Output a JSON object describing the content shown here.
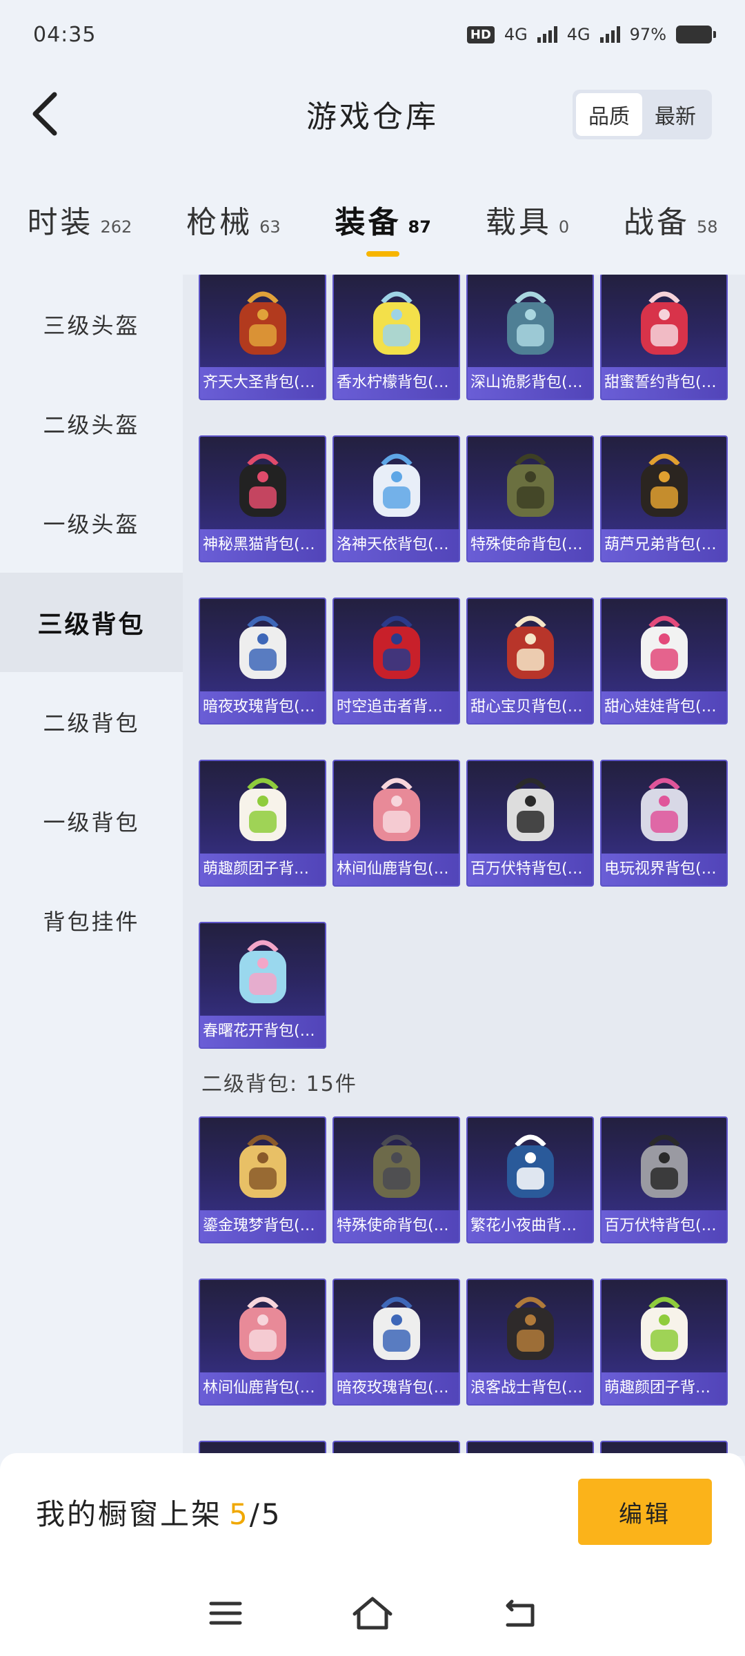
{
  "status_bar": {
    "time": "04:35",
    "hd": "HD",
    "net1": "4G",
    "net2": "4G",
    "battery": "97%"
  },
  "header": {
    "title": "游戏仓库",
    "sort_quality": "品质",
    "sort_newest": "最新"
  },
  "tabs": [
    {
      "label": "时装",
      "count": "262"
    },
    {
      "label": "枪械",
      "count": "63"
    },
    {
      "label": "装备",
      "count": "87"
    },
    {
      "label": "载具",
      "count": "0"
    },
    {
      "label": "战备",
      "count": "58"
    }
  ],
  "sidebar": {
    "items": [
      {
        "label": "三级头盔"
      },
      {
        "label": "二级头盔"
      },
      {
        "label": "一级头盔"
      },
      {
        "label": "三级背包"
      },
      {
        "label": "二级背包"
      },
      {
        "label": "一级背包"
      },
      {
        "label": "背包挂件"
      }
    ]
  },
  "grid1": {
    "items": [
      {
        "label": "齐天大圣背包(…",
        "art": "golden-red-armor-backpack"
      },
      {
        "label": "香水柠檬背包(…",
        "art": "yellow-duck-lemon-backpack"
      },
      {
        "label": "深山诡影背包(…",
        "art": "teal-shadow-backpack"
      },
      {
        "label": "甜蜜誓约背包(…",
        "art": "red-bow-heart-backpack"
      },
      {
        "label": "神秘黑猫背包(…",
        "art": "black-cat-backpack"
      },
      {
        "label": "洛神天依背包(…",
        "art": "white-blue-idol-backpack"
      },
      {
        "label": "特殊使命背包(…",
        "art": "olive-military-backpack"
      },
      {
        "label": "葫芦兄弟背包(…",
        "art": "black-gourd-backpack"
      },
      {
        "label": "暗夜玫瑰背包(…",
        "art": "white-rabbit-backpack"
      },
      {
        "label": "时空追击者背…",
        "art": "red-mech-backpack"
      },
      {
        "label": "甜心宝贝背包(…",
        "art": "cake-backpack"
      },
      {
        "label": "甜心娃娃背包(…",
        "art": "clown-doll-backpack"
      },
      {
        "label": "萌趣颜团子背…",
        "art": "green-sprout-doll-backpack"
      },
      {
        "label": "林间仙鹿背包(…",
        "art": "pink-deer-backpack"
      },
      {
        "label": "百万伏特背包(…",
        "art": "space-robot-backpack"
      },
      {
        "label": "电玩视界背包(…",
        "art": "arcade-backpack"
      },
      {
        "label": "春曙花开背包(…",
        "art": "butterfly-flower-backpack"
      }
    ]
  },
  "section2": {
    "heading": "二级背包: 15件"
  },
  "grid2": {
    "items": [
      {
        "label": "鎏金瑰梦背包(…",
        "art": "golden-cat-backpack"
      },
      {
        "label": "特殊使命背包(…",
        "art": "olive-grey-backpack"
      },
      {
        "label": "繁花小夜曲背…",
        "art": "daisy-blue-backpack"
      },
      {
        "label": "百万伏特背包(…",
        "art": "grey-robot-backpack"
      },
      {
        "label": "林间仙鹿背包(…",
        "art": "pink-deer-backpack"
      },
      {
        "label": "暗夜玫瑰背包(…",
        "art": "white-rabbit-backpack"
      },
      {
        "label": "浪客战士背包(…",
        "art": "dark-brown-backpack"
      },
      {
        "label": "萌趣颜团子背…",
        "art": "green-sprout-doll-backpack"
      },
      {
        "label": "",
        "art": "partial"
      },
      {
        "label": "",
        "art": "partial"
      },
      {
        "label": "",
        "art": "partial"
      },
      {
        "label": "",
        "art": "partial"
      }
    ]
  },
  "bottom": {
    "showcase_label": "我的橱窗上架",
    "showcase_count": "5",
    "showcase_total": "/5",
    "edit_label": "编辑"
  },
  "nav": {
    "menu_icon": "menu-icon",
    "home_icon": "home-icon",
    "back_icon": "back-icon"
  },
  "colors": {
    "accent": "#f7b500",
    "card_border": "#5d54c8",
    "card_label_bg": "#6a5ed6"
  }
}
